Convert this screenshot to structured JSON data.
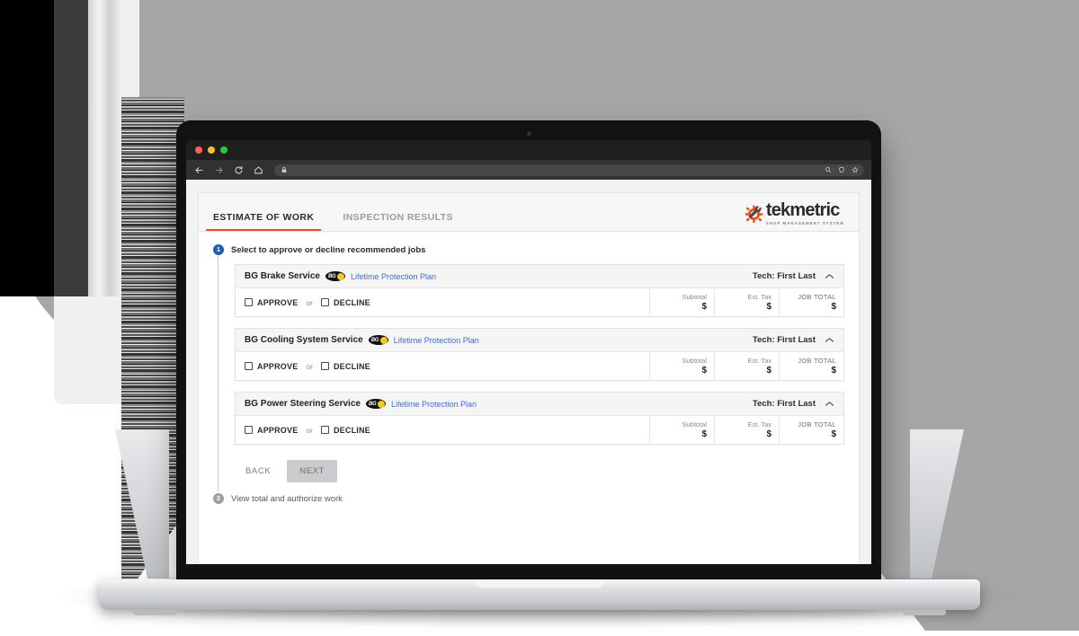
{
  "browser": {
    "window_controls": [
      "close",
      "minimize",
      "maximize"
    ],
    "nav_icons": [
      "back-arrow-icon",
      "forward-arrow-icon",
      "reload-icon",
      "home-icon"
    ],
    "omnibox": {
      "lock_icon": "lock-icon",
      "url": "",
      "right_icons": [
        "search-icon",
        "shield-icon",
        "bookmark-star-icon"
      ]
    }
  },
  "page": {
    "tabs": [
      {
        "label": "ESTIMATE OF WORK",
        "active": true
      },
      {
        "label": "INSPECTION RESULTS",
        "active": false
      }
    ],
    "brand": {
      "word": "tekmetric",
      "tagline": "SHOP MANAGEMENT SYSTEM",
      "gear_color": "#e8501f"
    },
    "accent_color": "#ea4b22",
    "link_color": "#3d6fc4",
    "steps": [
      {
        "number": "1",
        "label": "Select to approve or decline recommended jobs",
        "state": "active"
      },
      {
        "number": "2",
        "label": "View total and authorize work",
        "state": "inactive"
      }
    ],
    "jobs": [
      {
        "title": "BG Brake Service",
        "badge": "BG",
        "plan": "Lifetime Protection Plan",
        "tech": "Tech: First Last",
        "collapse_icon": "chevron-up-icon",
        "approve_label": "APPROVE",
        "or_label": "or",
        "decline_label": "DECLINE",
        "approve_checked": false,
        "decline_checked": false,
        "totals": [
          {
            "caption": "Subtotal",
            "value": "$"
          },
          {
            "caption": "Est. Tax",
            "value": "$"
          },
          {
            "caption": "JOB TOTAL",
            "value": "$"
          }
        ]
      },
      {
        "title": "BG Cooling System Service",
        "badge": "BG",
        "plan": "Lifetime Protection Plan",
        "tech": "Tech: First Last",
        "collapse_icon": "chevron-up-icon",
        "approve_label": "APPROVE",
        "or_label": "or",
        "decline_label": "DECLINE",
        "approve_checked": false,
        "decline_checked": false,
        "totals": [
          {
            "caption": "Subtotal",
            "value": "$"
          },
          {
            "caption": "Est. Tax",
            "value": "$"
          },
          {
            "caption": "JOB TOTAL",
            "value": "$"
          }
        ]
      },
      {
        "title": "BG Power Steering Service",
        "badge": "BG",
        "plan": "Lifetime Protection Plan",
        "tech": "Tech: First Last",
        "collapse_icon": "chevron-up-icon",
        "approve_label": "APPROVE",
        "or_label": "or",
        "decline_label": "DECLINE",
        "approve_checked": false,
        "decline_checked": false,
        "totals": [
          {
            "caption": "Subtotal",
            "value": "$"
          },
          {
            "caption": "Est. Tax",
            "value": "$"
          },
          {
            "caption": "JOB TOTAL",
            "value": "$"
          }
        ]
      }
    ],
    "footer": {
      "back_label": "BACK",
      "next_label": "NEXT",
      "next_disabled": true
    }
  }
}
